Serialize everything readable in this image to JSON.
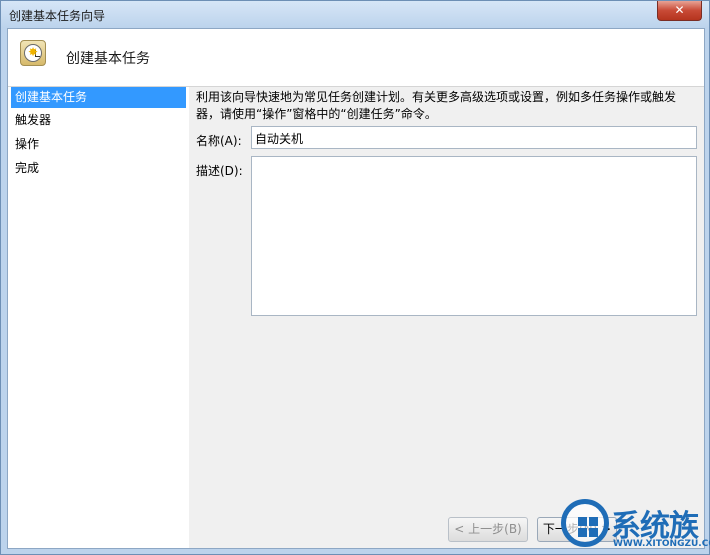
{
  "window": {
    "title": "创建基本任务向导",
    "close_label": "✕"
  },
  "header": {
    "title": "创建基本任务",
    "icon": "clock-icon"
  },
  "sidebar": {
    "items": [
      {
        "label": "创建基本任务",
        "active": true
      },
      {
        "label": "触发器",
        "active": false
      },
      {
        "label": "操作",
        "active": false
      },
      {
        "label": "完成",
        "active": false
      }
    ]
  },
  "main": {
    "description": "利用该向导快速地为常见任务创建计划。有关更多高级选项或设置，例如多任务操作或触发器，请使用“操作”窗格中的“创建任务”命令。",
    "name_label": "名称(A):",
    "name_value": "自动关机",
    "desc_label": "描述(D):",
    "desc_value": ""
  },
  "buttons": {
    "back_label": "< 上一步(B)",
    "next_label": "下一步(N) >"
  },
  "watermark": {
    "text": "系统族",
    "sub": "WWW.XITONGZU.COM"
  },
  "colors": {
    "selection": "#3399ff",
    "title_bar": "#bcd3ec",
    "close": "#c84a36",
    "watermark": "#1f6db7"
  }
}
